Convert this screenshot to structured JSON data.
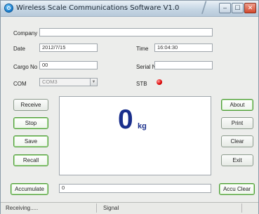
{
  "window": {
    "title": "Wireless Scale Communications Software V1.0",
    "minimize": "–",
    "maximize": "☐",
    "close": "✕"
  },
  "form": {
    "company_label": "Company",
    "company_value": "",
    "date_label": "Date",
    "date_value": "2012/7/15",
    "time_label": "Time",
    "time_value": "16:04:30",
    "cargo_label": "Cargo No",
    "cargo_value": "00",
    "serial_label": "Serial No",
    "serial_value": "",
    "com_label": "COM",
    "com_value": "COM3",
    "stb_label": "STB"
  },
  "buttons": {
    "receive": "Receive",
    "stop": "Stop",
    "save": "Save",
    "recall": "Recall",
    "about": "About",
    "print": "Print",
    "clear": "Clear",
    "exit": "Exit",
    "accumulate": "Accumulate",
    "accu_clear": "Accu Clear"
  },
  "display": {
    "value": "0",
    "unit": "kg"
  },
  "accumulate_value": "0",
  "status": {
    "left": "Receiving.....",
    "right": "Signal"
  },
  "colors": {
    "display_text": "#1a2f8c",
    "stb_led": "#dd0000",
    "green_button_border": "#4d9a38"
  }
}
